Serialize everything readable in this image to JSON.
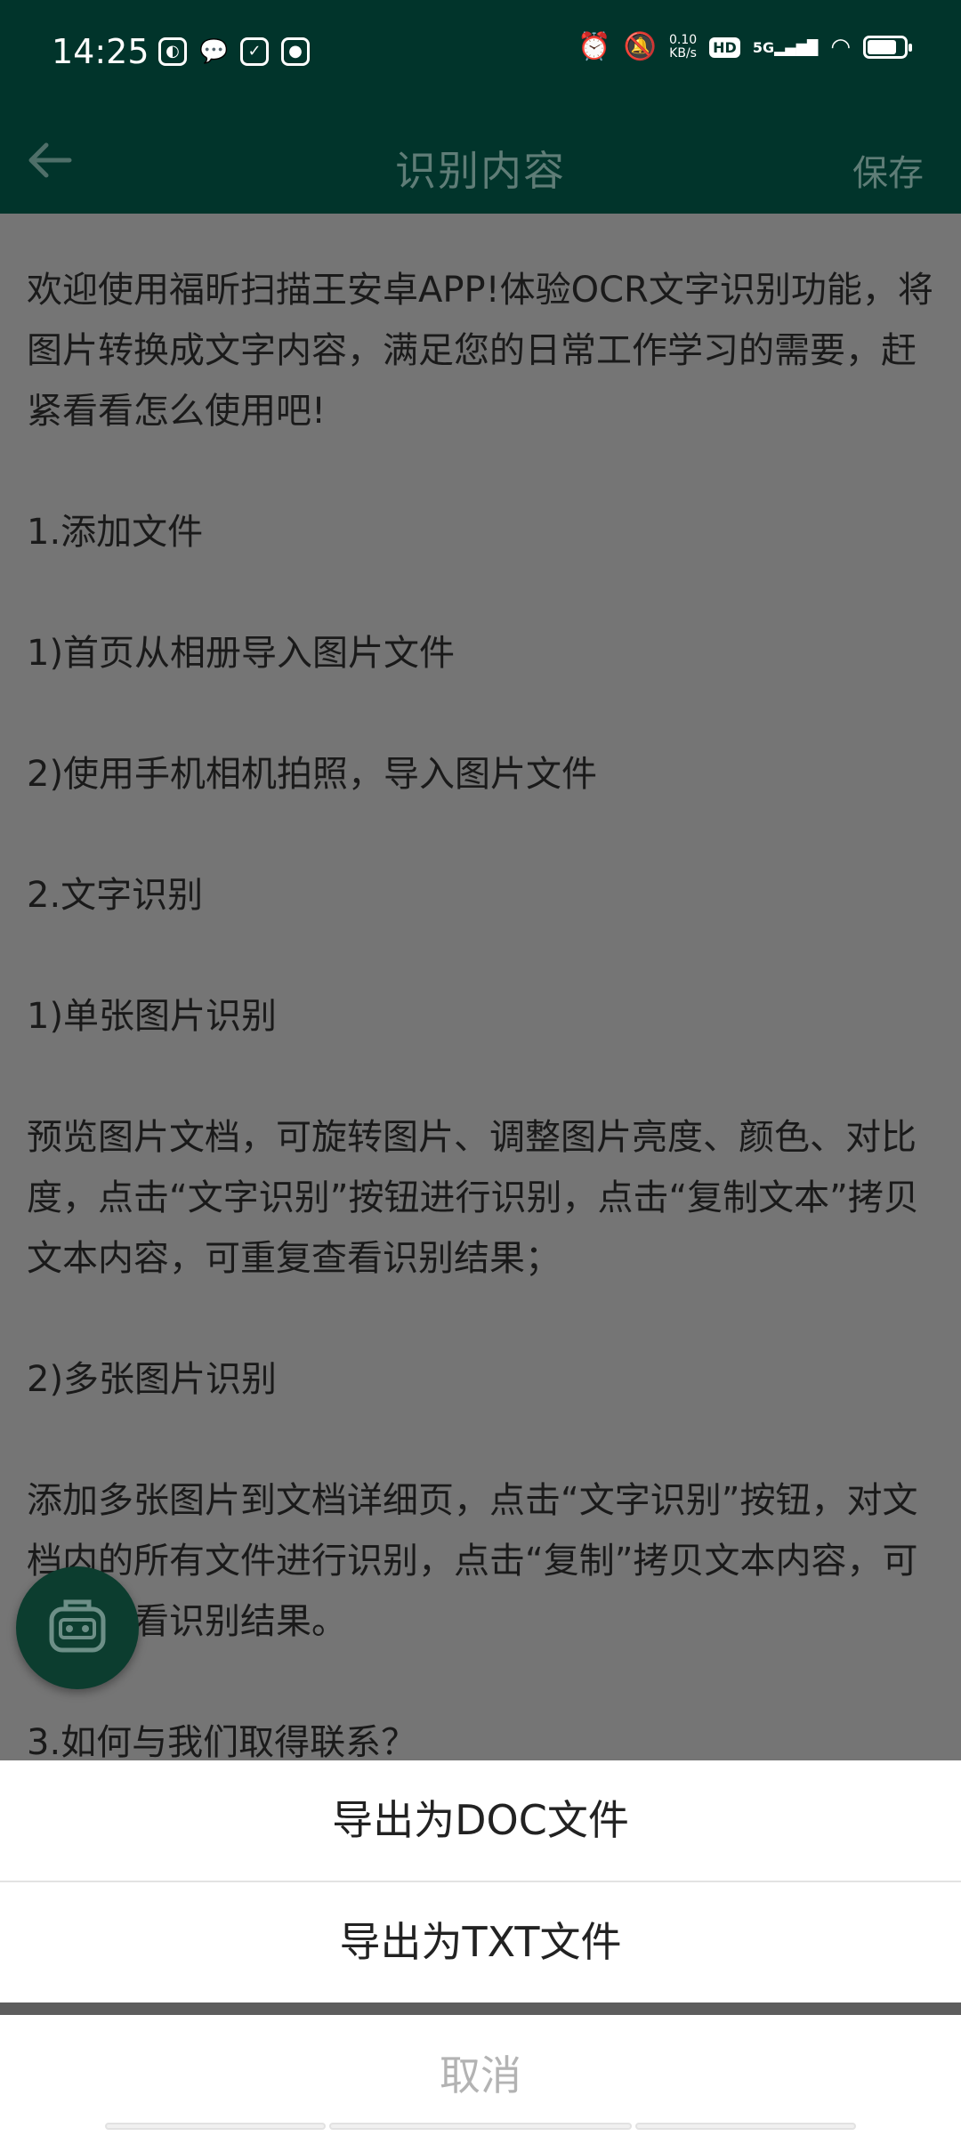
{
  "status_bar": {
    "time": "14:25",
    "net_speed_value": "0.10",
    "net_speed_unit": "KB/s",
    "hd_label": "HD",
    "network_label": "5G",
    "icons": [
      "photo-app-icon",
      "wechat-icon",
      "inbox-icon",
      "chat-icon",
      "alarm-icon",
      "mute-icon",
      "wifi-icon",
      "battery-icon"
    ]
  },
  "app_bar": {
    "title": "识别内容",
    "save_label": "保存"
  },
  "content": {
    "text": "欢迎使用福昕扫描王安卓APP!体验OCR文字识别功能，将图片转换成文字内容，满足您的日常工作学习的需要，赶紧看看怎么使用吧!\n\n1.添加文件\n\n1)首页从相册导入图片文件\n\n2)使用手机相机拍照，导入图片文件\n\n2.文字识别\n\n1)单张图片识别\n\n预览图片文档，可旋转图片、调整图片亮度、颜色、对比度，点击“文字识别”按钮进行识别，点击“复制文本”拷贝文本内容，可重复查看识别结果；\n\n2)多张图片识别\n\n添加多张图片到文档详细页，点击“文字识别”按钮，对文档内的所有文件进行识别，点击“复制”拷贝文本内容，可重复查看识别结果。\n\n3.如何与我们取得联系？"
  },
  "sheet": {
    "export_doc": "导出为DOC文件",
    "export_txt": "导出为TXT文件",
    "cancel": "取消"
  },
  "colors": {
    "header": "#01342b",
    "overlay": "#757575",
    "sheet_bg": "#ffffff",
    "cancel_text": "#b3b3b3"
  }
}
